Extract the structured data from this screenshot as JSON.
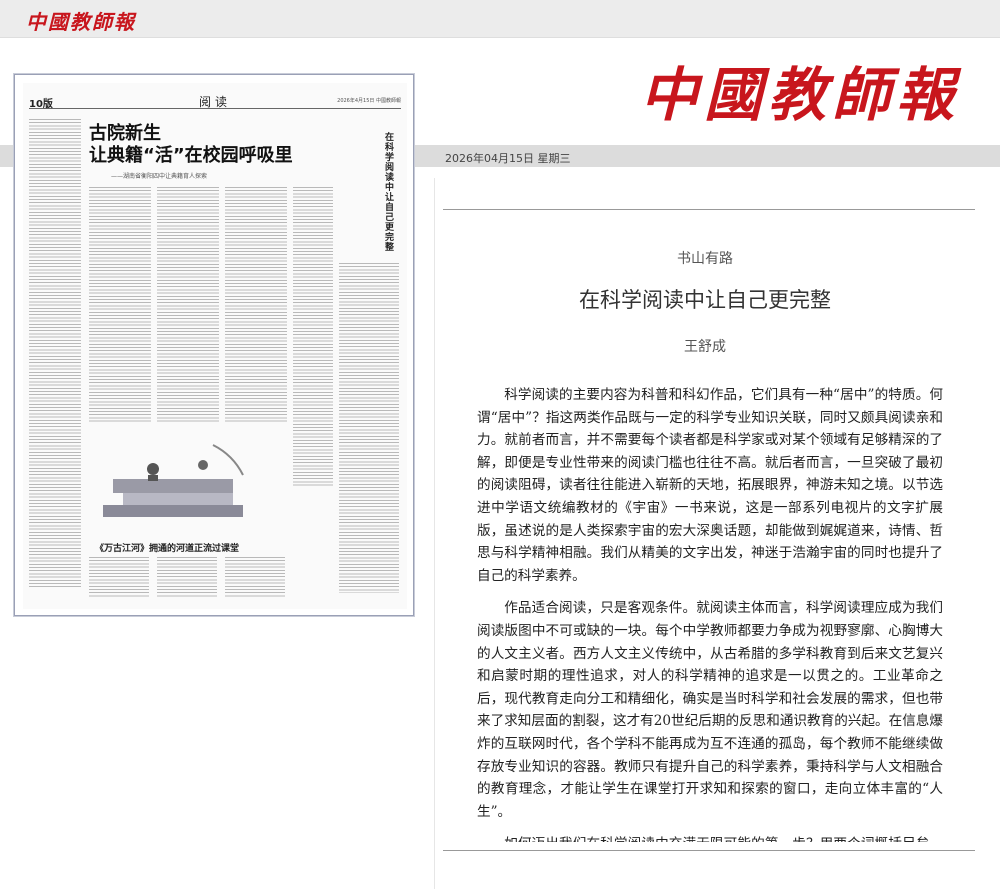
{
  "top_logo": "中國教師報",
  "brand": "中國教師報",
  "date": "2026年04月15日  星期三",
  "thumbnail": {
    "page_no": "10版",
    "section": "阅读",
    "header_right": "2026年4月15日  中國教師報",
    "headline_1": "古院新生",
    "headline_2": "让典籍“活”在校园呼吸里",
    "subheadline": "——湖南省衡阳四中让典籍育人探索",
    "vertical_title": "在科学阅读中让自己更完整",
    "second_headline": "《万古江河》拥通的河道正流过课堂"
  },
  "article": {
    "column": "书山有路",
    "title": "在科学阅读中让自己更完整",
    "author": "王舒成",
    "paragraphs": [
      "科学阅读的主要内容为科普和科幻作品，它们具有一种“居中”的特质。何谓“居中”？指这两类作品既与一定的科学专业知识关联，同时又颇具阅读亲和力。就前者而言，并不需要每个读者都是科学家或对某个领域有足够精深的了解，即便是专业性带来的阅读门槛也往往不高。就后者而言，一旦突破了最初的阅读阻碍，读者往往能进入崭新的天地，拓展眼界，神游未知之境。以节选进中学语文统编教材的《宇宙》一书来说，这是一部系列电视片的文字扩展版，虽述说的是人类探索宇宙的宏大深奥话题，却能做到娓娓道来，诗情、哲思与科学精神相融。我们从精美的文字出发，神迷于浩瀚宇宙的同时也提升了自己的科学素养。",
      "作品适合阅读，只是客观条件。就阅读主体而言，科学阅读理应成为我们阅读版图中不可或缺的一块。每个中学教师都要力争成为视野寥廓、心胸博大的人文主义者。西方人文主义传统中，从古希腊的多学科教育到后来文艺复兴和启蒙时期的理性追求，对人的科学精神的追求是一以贯之的。工业革命之后，现代教育走向分工和精细化，确实是当时科学和社会发展的需求，但也带来了求知层面的割裂，这才有20世纪后期的反思和通识教育的兴起。在信息爆炸的互联网时代，各个学科不能再成为互不连通的孤岛，每个教师不能继续做存放专业知识的容器。教师只有提升自己的科学素养，秉持科学与人文相融合的教育理念，才能让学生在课堂打开求知和探索的窗口，走向立体丰富的“人生”。",
      "如何迈出我们在科学阅读中充满无限可能的第一步？用两个词概括足矣。一曰“囫囵吞枣”，二曰“不求甚解”。“囫囵吞枣”是无论如何先得读起来，争取读完一本。“不求甚解”是不用纠结书中不懂的部分，暂"
    ]
  }
}
